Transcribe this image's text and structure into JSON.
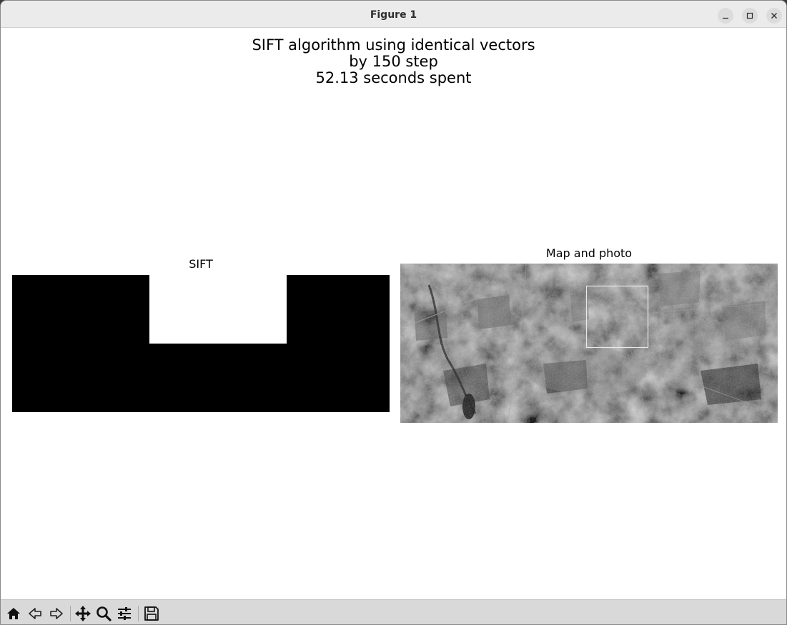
{
  "window": {
    "title": "Figure 1",
    "controls": [
      "minimize-icon",
      "maximize-icon",
      "close-icon"
    ]
  },
  "figure": {
    "suptitle_lines": [
      "SIFT algorithm using identical vectors",
      "by 150 step",
      "52.13 seconds spent"
    ],
    "axes": {
      "sift_title": "SIFT",
      "map_title": "Map and photo"
    }
  },
  "colors": {
    "sift_fill": "#000000",
    "sift_notch": "#ffffff",
    "match_box": "#e8e8e8"
  },
  "toolbar": {
    "items": [
      "home-icon",
      "back-icon",
      "forward-icon",
      "pan-icon",
      "zoom-icon",
      "configure-subplots-icon",
      "save-icon"
    ]
  }
}
